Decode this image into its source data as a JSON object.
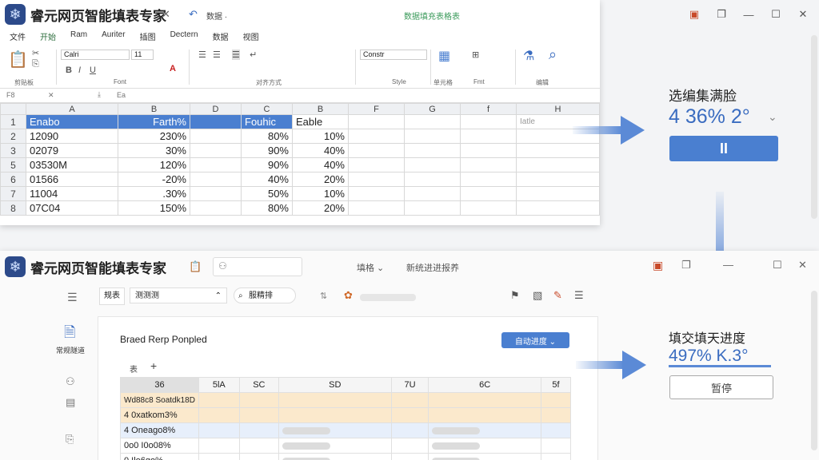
{
  "app_title": "睿元网页智能填表专家",
  "top_window": {
    "tab_label": "数据 ·",
    "doc_title": "数据填充表格表",
    "menu": [
      "文件",
      "开始",
      "Ram",
      "Auriter",
      "插图",
      "Dectern",
      "数据",
      "视图"
    ],
    "ribbon_groups": [
      "剪贴板",
      "Font",
      "对齐方式",
      "Style",
      "单元格",
      "Fmt",
      "编辑"
    ],
    "font_name": "Calri",
    "font_size": "11",
    "style_name": "Constr",
    "formula_ref": "F8",
    "formula_content": "Ea",
    "col_headers": [
      "",
      "A",
      "B",
      "D",
      "C",
      "B",
      "F",
      "G",
      "f",
      "H"
    ],
    "header_row": {
      "rn": "1",
      "a": "Enabo",
      "b": "Farth%",
      "d": "",
      "c": "Fouhic",
      "e": "Eable"
    },
    "rows": [
      {
        "rn": "2",
        "a": "12090",
        "b": "230%",
        "c": "80%",
        "e": "10%"
      },
      {
        "rn": "3",
        "a": "02079",
        "b": "30%",
        "c": "90%",
        "e": "40%"
      },
      {
        "rn": "5",
        "a": "03530M",
        "b": "120%",
        "c": "90%",
        "e": "40%"
      },
      {
        "rn": "6",
        "a": "01566",
        "b": "-20%",
        "c": "40%",
        "e": "20%"
      },
      {
        "rn": "7",
        "a": "11004",
        "b": ".30%",
        "c": "50%",
        "e": "10%"
      },
      {
        "rn": "8",
        "a": "07C04",
        "b": "150%",
        "c": "80%",
        "e": "20%"
      }
    ],
    "side_hint": "Iatle"
  },
  "top_panel": {
    "label": "选编集满脸",
    "value": "4 36% 2°",
    "pause_glyph": "II"
  },
  "bottom_window": {
    "nav1": "填格 ⌄",
    "nav2": "新统进进报养",
    "sidebar_label": "常规隧道",
    "toolbar_label": "规表",
    "dropdown_value": "测测测",
    "search_value": "服精排",
    "card_title": "Braed Rerp Ponpled",
    "auto_button": "自动进度 ⌄",
    "add_tab": "+",
    "sheet_tab": "表",
    "col_headers": [
      "36",
      "5lA",
      "SC",
      "SD",
      "7U",
      "6C",
      "5f"
    ],
    "rows": [
      "Wd88c8 Soatdk18D",
      "4 0xatkom3%",
      "4 Oneago8%",
      "0o0 I0o08%",
      "0 Ilo6go%"
    ]
  },
  "bottom_panel": {
    "label": "填交填天进度",
    "value": "497% K.3°",
    "pause_button": "暂停"
  },
  "colors": {
    "accent": "#4a7fd0",
    "selection_row": "#fbe9cc"
  }
}
